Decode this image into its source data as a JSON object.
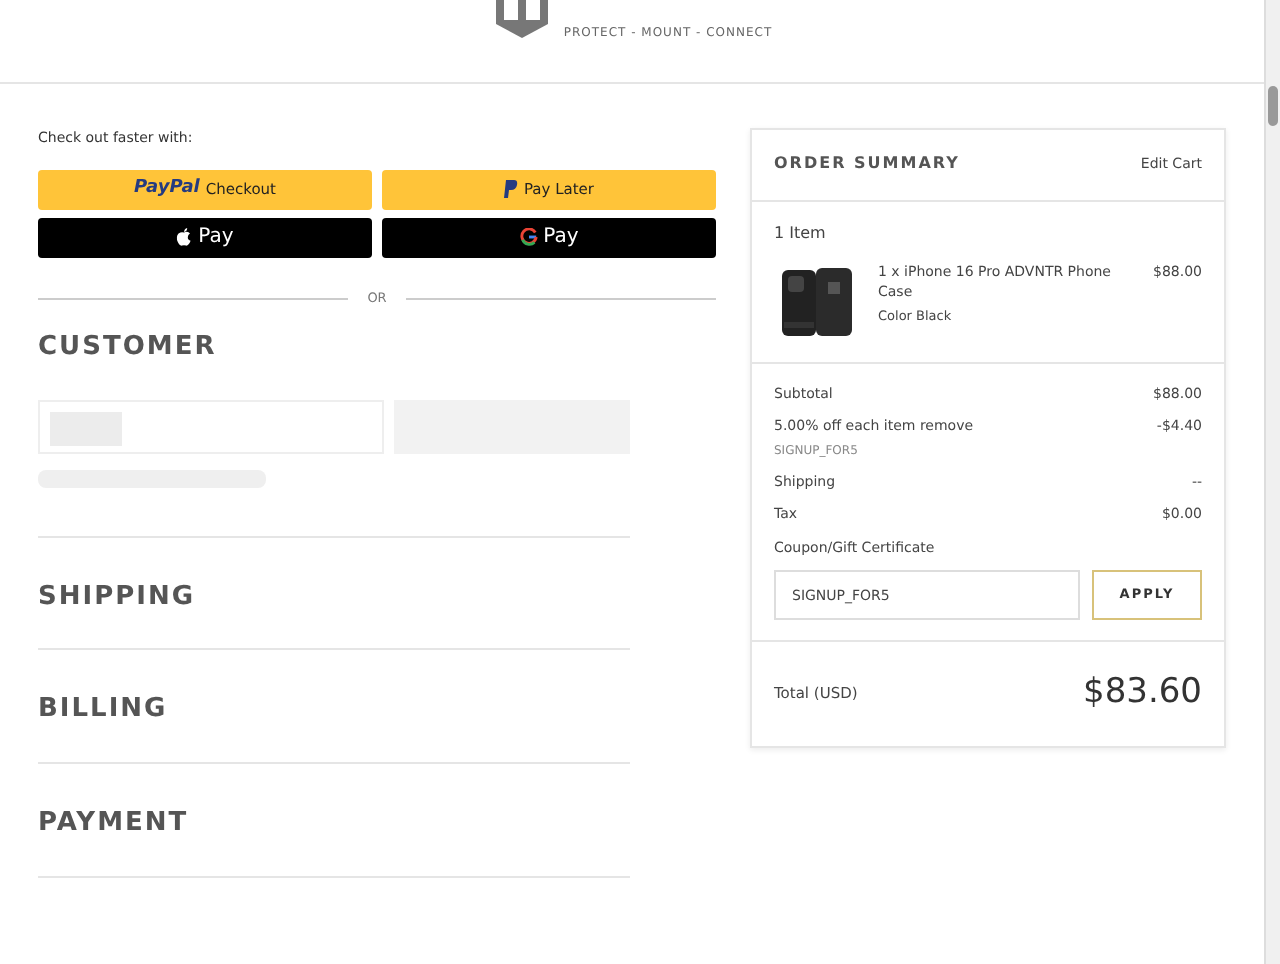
{
  "header": {
    "tagline": "PROTECT - MOUNT - CONNECT"
  },
  "express": {
    "intro": "Check out faster with:",
    "buttons": [
      {
        "kind": "paypal",
        "brand": "PayPal",
        "label": "Checkout"
      },
      {
        "kind": "paylater",
        "label": "Pay Later"
      },
      {
        "kind": "applepay",
        "label": "Pay"
      },
      {
        "kind": "googlepay",
        "label": "Pay"
      }
    ],
    "divider": "OR"
  },
  "sections": [
    {
      "title": "CUSTOMER",
      "loading": true
    },
    {
      "title": "SHIPPING",
      "loading": false
    },
    {
      "title": "BILLING",
      "loading": false
    },
    {
      "title": "PAYMENT",
      "loading": false
    }
  ],
  "summary": {
    "title": "ORDER SUMMARY",
    "edit": "Edit Cart",
    "count": "1 Item",
    "items": [
      {
        "kind": "picture",
        "name": "1 x iPhone 16 Pro ADVNTR Phone Case",
        "option": "Color Black",
        "price": "$88.00"
      }
    ],
    "lines": [
      {
        "label": "Subtotal",
        "value": "$88.00"
      },
      {
        "label": "5.00% off each item remove",
        "code": "SIGNUP_FOR5",
        "value": "-$4.40"
      },
      {
        "label": "Shipping",
        "value": "--"
      },
      {
        "label": "Tax",
        "value": "$0.00"
      }
    ],
    "coupon": {
      "label": "Coupon/Gift Certificate",
      "value": "SIGNUP_FOR5",
      "button": "APPLY"
    },
    "total": {
      "label": "Total (USD)",
      "value": "$83.60"
    }
  }
}
